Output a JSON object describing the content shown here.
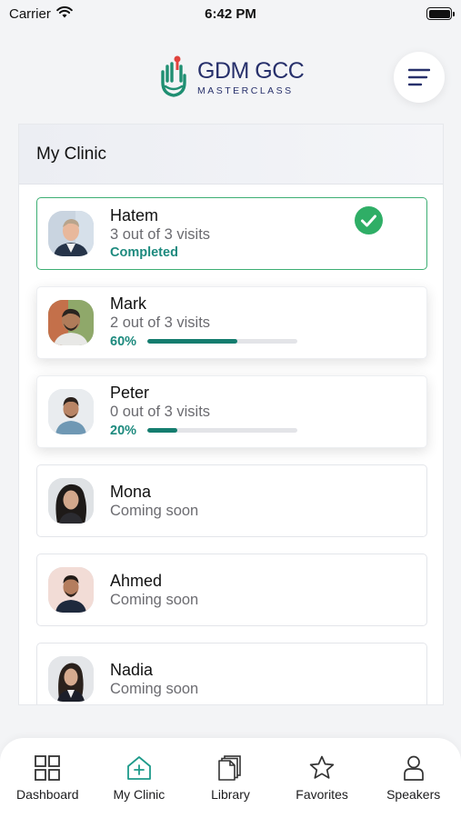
{
  "status_bar": {
    "carrier": "Carrier",
    "time": "6:42 PM"
  },
  "header": {
    "logo_main": "GDM GCC",
    "logo_sub": "MASTERCLASS"
  },
  "clinic": {
    "title": "My Clinic",
    "patients": [
      {
        "name": "Hatem",
        "visits": "3 out of 3 visits",
        "status": "Completed",
        "state": "completed"
      },
      {
        "name": "Mark",
        "visits": "2 out of 3 visits",
        "progress_label": "60%",
        "progress": 0.6,
        "state": "in-progress"
      },
      {
        "name": "Peter",
        "visits": "0 out of 3 visits",
        "progress_label": "20%",
        "progress": 0.2,
        "state": "in-progress"
      },
      {
        "name": "Mona",
        "status": "Coming soon",
        "state": "locked"
      },
      {
        "name": "Ahmed",
        "status": "Coming soon",
        "state": "locked"
      },
      {
        "name": "Nadia",
        "status": "Coming soon",
        "state": "locked"
      }
    ]
  },
  "tabbar": {
    "tabs": [
      {
        "label": "Dashboard",
        "icon": "dashboard-grid-icon"
      },
      {
        "label": "My Clinic",
        "icon": "clinic-house-icon",
        "active": true
      },
      {
        "label": "Library",
        "icon": "library-docs-icon"
      },
      {
        "label": "Favorites",
        "icon": "star-icon"
      },
      {
        "label": "Speakers",
        "icon": "person-icon"
      }
    ]
  },
  "colors": {
    "accent": "#157d6f",
    "success": "#2fae66",
    "brand": "#27306b",
    "brand_green": "#1f8f72",
    "brand_red": "#e0433d"
  }
}
